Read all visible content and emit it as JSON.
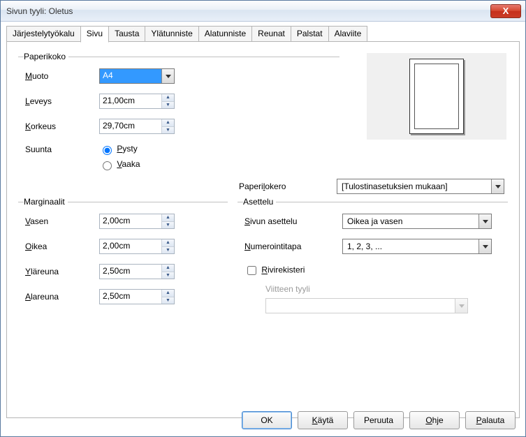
{
  "window": {
    "title": "Sivun tyyli: Oletus"
  },
  "tabs": [
    "Järjestelytyökalu",
    "Sivu",
    "Tausta",
    "Ylätunniste",
    "Alatunniste",
    "Reunat",
    "Palstat",
    "Alaviite"
  ],
  "active_tab": 1,
  "paper": {
    "legend": "Paperikoko",
    "format_label": "Muoto",
    "format_value": "A4",
    "width_label": "Leveys",
    "width_value": "21,00cm",
    "height_label": "Korkeus",
    "height_value": "29,70cm",
    "orientation_label": "Suunta",
    "orientation_portrait": "Pysty",
    "orientation_landscape": "Vaaka",
    "tray_label": "Paperilokero",
    "tray_value": "[Tulostinasetuksien mukaan]"
  },
  "margins": {
    "legend": "Marginaalit",
    "left_label": "Vasen",
    "left_value": "2,00cm",
    "right_label": "Oikea",
    "right_value": "2,00cm",
    "top_label": "Yläreuna",
    "top_value": "2,50cm",
    "bottom_label": "Alareuna",
    "bottom_value": "2,50cm"
  },
  "layout": {
    "legend": "Asettelu",
    "pagelayout_label": "Sivun asettelu",
    "pagelayout_value": "Oikea ja vasen",
    "numbering_label": "Numerointitapa",
    "numbering_value": "1, 2, 3, ...",
    "register_label": "Rivirekisteri",
    "refstyle_label": "Viitteen tyyli"
  },
  "buttons": {
    "ok": "OK",
    "apply": "Käytä",
    "cancel": "Peruuta",
    "help": "Ohje",
    "reset": "Palauta"
  }
}
